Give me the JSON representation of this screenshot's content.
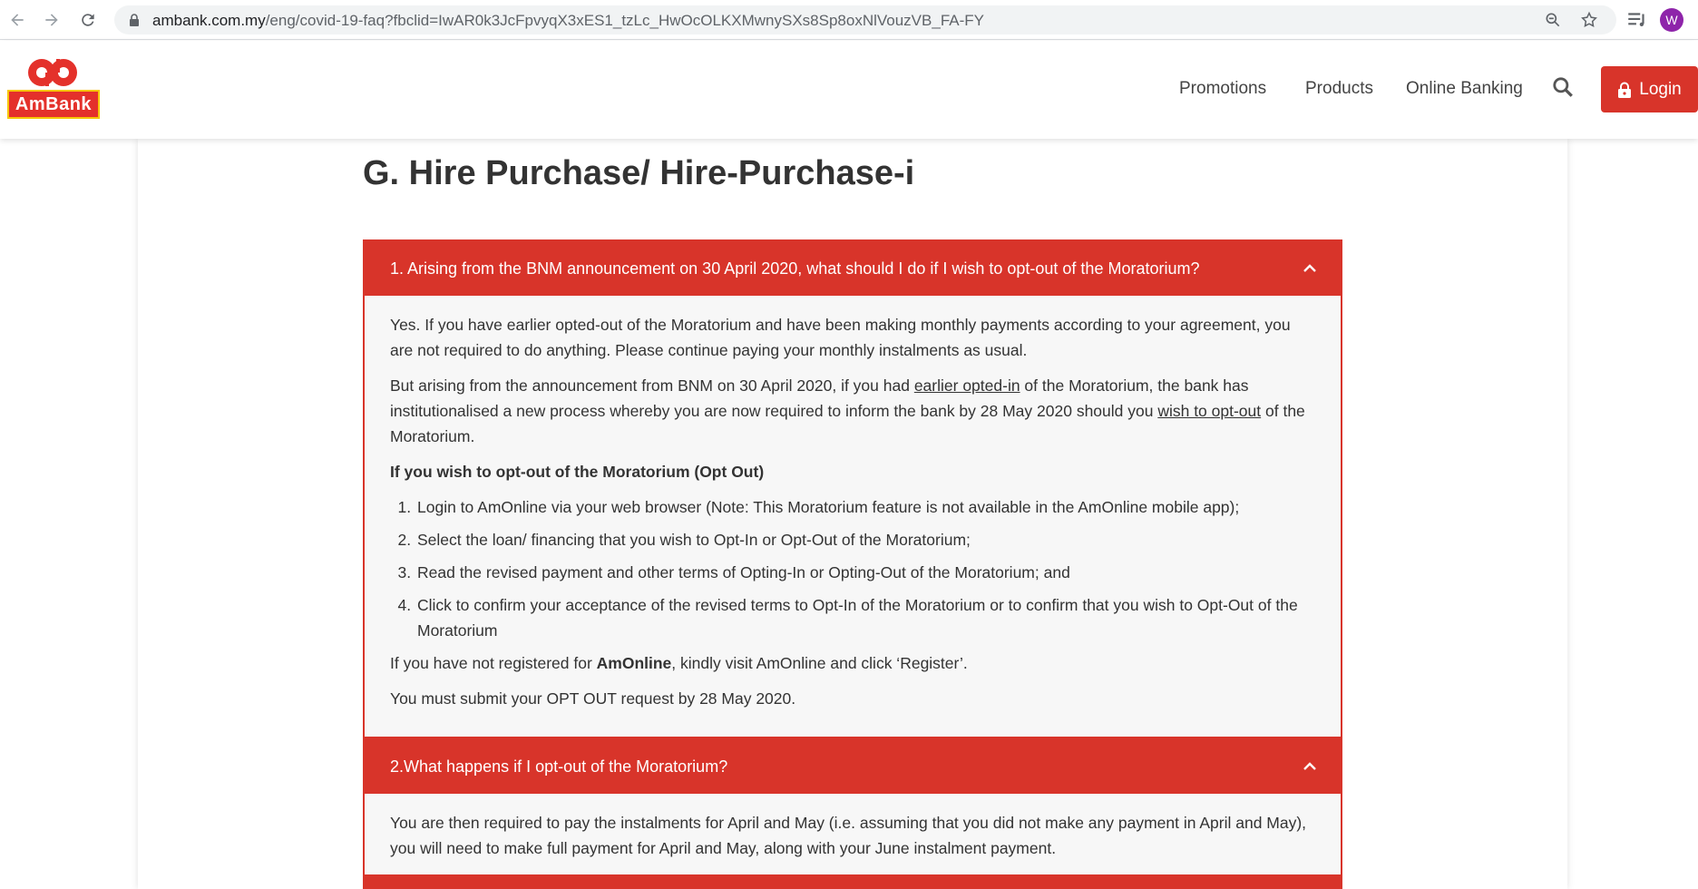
{
  "browser": {
    "url_host": "ambank.com.my",
    "url_path": "/eng/covid-19-faq?fbclid=IwAR0k3JcFpvyqX3xES1_tzLc_HwOcOLKXMwnySXs8Sp8oxNlVouzVB_FA-FY",
    "avatar_letter": "W"
  },
  "header": {
    "logo_text": "AmBank",
    "menu": [
      "Promotions",
      "Products",
      "Online Banking"
    ],
    "login_label": "Login"
  },
  "section_title": "G. Hire Purchase/ Hire-Purchase-i",
  "faq": [
    {
      "question": "1. Arising from the BNM announcement on 30 April 2020, what should I do if I wish to opt-out of the Moratorium?",
      "p1": "Yes. If you have earlier opted-out of the Moratorium and have been making monthly payments according to your agreement, you are not required to do anything. Please continue paying your monthly instalments as usual.",
      "p2_a": "But arising from the announcement from BNM on 30 April 2020, if you had ",
      "p2_link1": "earlier opted-in",
      "p2_b": " of the Moratorium, the bank has institutionalised a new process whereby you are now required to inform the bank by 28 May 2020 should you ",
      "p2_link2": "wish to opt-out",
      "p2_c": " of the Moratorium.",
      "subheading": "If you wish to opt-out of the Moratorium (Opt Out)",
      "steps": [
        "Login to AmOnline via your web browser (Note: This Moratorium feature is not available in the AmOnline mobile app);",
        "Select the loan/ financing that you wish to Opt-In or Opt-Out of the Moratorium;",
        "Read the revised payment and other terms of Opting-In or Opting-Out of the Moratorium; and",
        "Click to confirm your acceptance of the revised terms to Opt-In of the Moratorium or to confirm that you wish to Opt-Out of the Moratorium"
      ],
      "p3_a": "If you have not registered for ",
      "p3_bold": "AmOnline",
      "p3_b": ", kindly visit AmOnline and click ‘Register’.",
      "p4": "You must submit your OPT OUT request by 28 May 2020."
    },
    {
      "question": "2.What happens if I opt-out of the Moratorium?",
      "p1": "You are then required to pay the instalments for April and May (i.e. assuming that you did not make any payment in April and May), you will need to make full payment for April and May, along with your June instalment payment."
    }
  ],
  "colors": {
    "brand_red": "#d8342a",
    "logo_yellow": "#f7c600"
  }
}
